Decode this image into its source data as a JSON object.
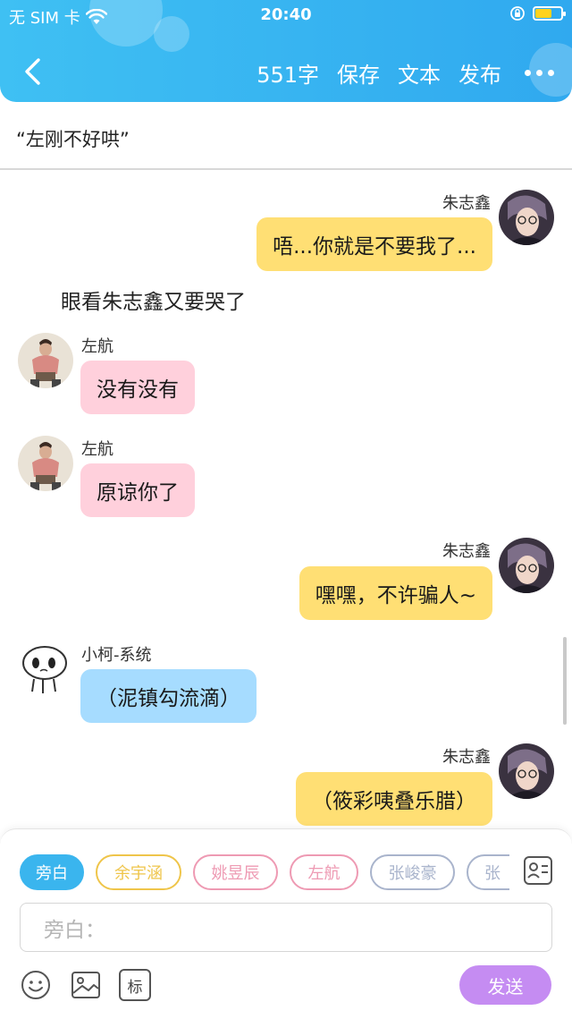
{
  "status_bar": {
    "carrier": "无 SIM 卡",
    "time": "20:40"
  },
  "nav": {
    "word_count": "551字",
    "save_label": "保存",
    "text_label": "文本",
    "publish_label": "发布"
  },
  "story_title": "“左刚不好哄”",
  "messages": [
    {
      "type": "right",
      "name": "朱志鑫",
      "text": "唔...你就是不要我了...",
      "color": "yellow",
      "avatar": "zhu"
    },
    {
      "type": "narration",
      "text": "眼看朱志鑫又要哭了"
    },
    {
      "type": "left",
      "name": "左航",
      "text": "没有没有",
      "color": "pink",
      "avatar": "zuo"
    },
    {
      "type": "left",
      "name": "左航",
      "text": "原谅你了",
      "color": "pink",
      "avatar": "zuo"
    },
    {
      "type": "right",
      "name": "朱志鑫",
      "text": "嘿嘿，不许骗人~",
      "color": "yellow",
      "avatar": "zhu"
    },
    {
      "type": "left",
      "name": "小柯-系统",
      "text": "（泥镇勾流滴）",
      "color": "blue",
      "avatar": "ko"
    },
    {
      "type": "right",
      "name": "朱志鑫",
      "text": "（筱彩咦叠乐腊）",
      "color": "yellow",
      "avatar": "zhu"
    }
  ],
  "characters": [
    {
      "label": "旁白",
      "color": "#3ab5ee",
      "active": true
    },
    {
      "label": "余宇涵",
      "color": "#efc54a",
      "active": false
    },
    {
      "label": "姚昱辰",
      "color": "#ee9ab3",
      "active": false
    },
    {
      "label": "左航",
      "color": "#ee9ab3",
      "active": false
    },
    {
      "label": "张峻豪",
      "color": "#a9b4cc",
      "active": false
    },
    {
      "label": "张",
      "color": "#a9b4cc",
      "active": false
    }
  ],
  "input": {
    "placeholder": "旁白："
  },
  "send_label": "发送",
  "toolbar": {
    "mark_label": "标"
  }
}
